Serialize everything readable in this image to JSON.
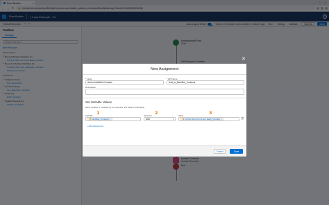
{
  "browser": {
    "tab_title": "Flow Builder",
    "tab_close": "×",
    "url": "momentum-computing-884.lightning.force.com/builder_platform_interaction/flowBuilder.app?flowId=301D0000000MfQ4",
    "lock": "🔒",
    "win_min": "–",
    "win_max": "□",
    "win_close": "×",
    "back": "←",
    "forward": "→",
    "reload": "↻"
  },
  "app": {
    "title": "Flow Builder",
    "back_label": "< Loop Example - V1",
    "help": "?"
  },
  "toolbar": {
    "select_elements": "Select Elements",
    "undo": "↶",
    "redo": "↷",
    "layout": "Auto-Layout Mode",
    "version_info": "Version 3, Inactive   Last modified 2 minutes ago",
    "run": "Run",
    "debug": "Debug",
    "activate": "Activate",
    "save_as": "Save As",
    "save": "Save"
  },
  "sidebar": {
    "title": "Toolbox",
    "tab": "Manager",
    "search_placeholder": "Search this flow...",
    "new_resource": "New Resource",
    "resources_heading": "RESOURCES",
    "elements_heading": "ELEMENTS",
    "items": [
      {
        "label": "Record (Single) Variables (1)",
        "sub": false
      },
      {
        "label": "Current Item from Loop Each_Contact",
        "sub": true
      },
      {
        "label": "Record Collection Variables (2)",
        "sub": false
      },
      {
        "label": "Contacts from Get_Example_Contacts",
        "sub": true
      },
      {
        "label": "Modified_Contacts",
        "sub": true
      }
    ],
    "element_items": [
      {
        "label": "Assignments (1)",
        "sub": false
      },
      {
        "label": "Set_Description",
        "sub": true
      },
      {
        "label": "Get Records (1)",
        "sub": false
      },
      {
        "label": "Get_Example_Contacts",
        "sub": true
      },
      {
        "label": "Loops (1)",
        "sub": false
      },
      {
        "label": "Each_Contact",
        "sub": true
      },
      {
        "label": "Update Records (1)",
        "sub": false
      },
      {
        "label": "Update_Contacts",
        "sub": true
      }
    ]
  },
  "canvas": {
    "start_title": "Autolaunched Flow",
    "start_sub": "Start",
    "get_title": "Get Example Contacts",
    "update_title": "Update Contacts",
    "update_sub": "Update Records",
    "end_label": "End"
  },
  "modal": {
    "close": "✕",
    "title": "New Assignment",
    "label_field": "* Label",
    "label_value": "Add to Modified Contacts",
    "api_field": "* API Name",
    "api_value": "Add_to_Modified_Contacts",
    "desc_field": "Description",
    "section_title": "Set Variable Values",
    "section_desc": "Each variable is modified by the operator and value combination.",
    "variable_label": "Variable",
    "operator_label": "Operator",
    "value_label": "Value",
    "variable_value": "Modified_Contacts",
    "operator_value": "Add",
    "value_value": "Current Item from Loop Each_Contact",
    "pill_x": "×",
    "chevron": "▾",
    "trash": "🗑",
    "num_1": "1",
    "num_2": "2",
    "num_3": "3",
    "add_assignment": "+ Add Assignment",
    "cancel": "Cancel",
    "done": "Done"
  }
}
